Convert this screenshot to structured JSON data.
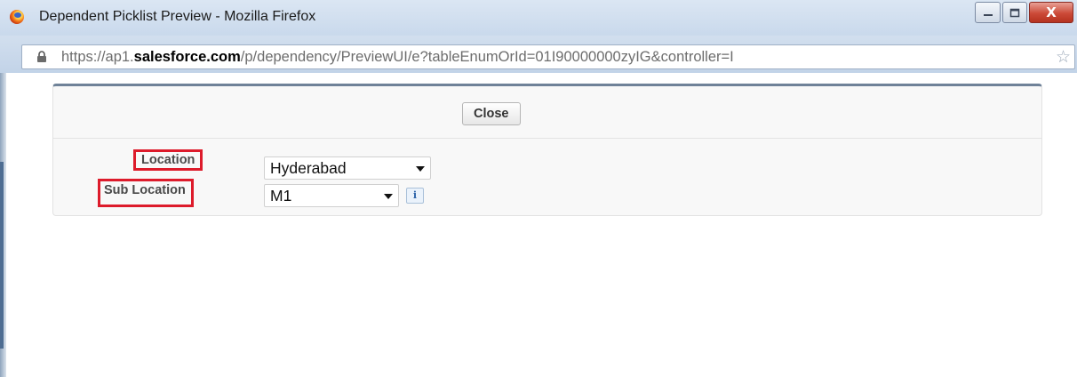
{
  "window": {
    "title": "Dependent Picklist Preview - Mozilla Firefox",
    "app_icon": "firefox-icon",
    "close_glyph": "X"
  },
  "address_bar": {
    "url_prefix": "https://ap1.",
    "url_domain": "salesforce.com",
    "url_rest": "/p/dependency/PreviewUI/e?tableEnumOrId=01I90000000zyIG&controller=I"
  },
  "toolbar": {
    "close_label": "Close"
  },
  "form": {
    "location": {
      "label": "Location",
      "value": "Hyderabad"
    },
    "sub_location": {
      "label": "Sub Location",
      "value": "M1",
      "info_glyph": "i"
    }
  },
  "colors": {
    "highlight_border": "#dd1b2b",
    "panel_top_border": "#6f8298"
  }
}
